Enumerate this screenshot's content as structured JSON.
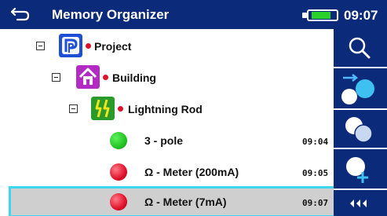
{
  "header": {
    "title": "Memory Organizer",
    "clock": "09:07",
    "colors": {
      "background": "#0c2a7a",
      "battery_fill": "#2ad12a"
    }
  },
  "tree": {
    "items": [
      {
        "label": "Project",
        "icon": "project-icon",
        "expanded": true
      },
      {
        "label": "Building",
        "icon": "building-icon",
        "expanded": true
      },
      {
        "label": "Lightning Rod",
        "icon": "lightning-rod-icon",
        "expanded": true
      },
      {
        "label": "3 - pole",
        "status": "pass",
        "status_color": "#22c422",
        "time": "09:04"
      },
      {
        "label": "Ω - Meter (200mA)",
        "status": "fail",
        "status_color": "#e0102a",
        "time": "09:05"
      },
      {
        "label": "Ω - Meter (7mA)",
        "status": "fail",
        "status_color": "#e0102a",
        "time": "09:07",
        "selected": true
      }
    ]
  },
  "sidebar": {
    "buttons": [
      {
        "icon": "search-icon"
      },
      {
        "icon": "add-measurement-icon"
      },
      {
        "icon": "clone-icon"
      },
      {
        "icon": "add-node-icon"
      },
      {
        "icon": "more-icon"
      }
    ]
  }
}
